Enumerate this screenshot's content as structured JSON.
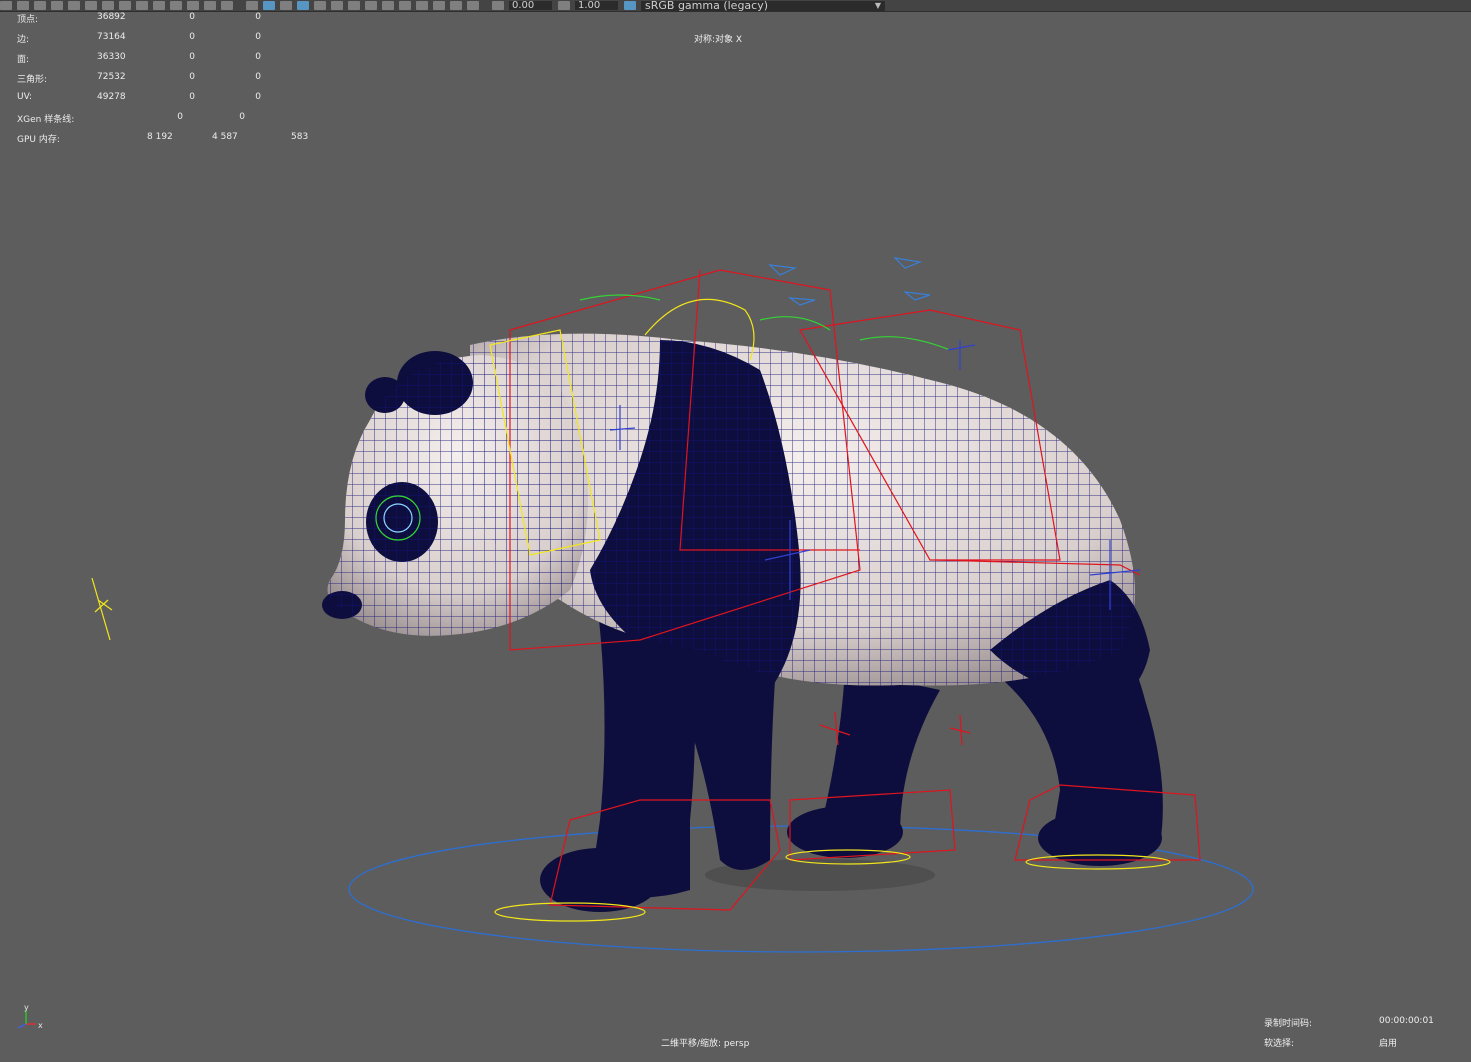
{
  "toolbar": {
    "exposure_value": "0.00",
    "gamma_value": "1.00",
    "color_space": "sRGB gamma (legacy)"
  },
  "hud": {
    "rows": [
      {
        "label": "顶点:",
        "v1": "36892",
        "v2": "0",
        "v3": "0"
      },
      {
        "label": "边:",
        "v1": "73164",
        "v2": "0",
        "v3": "0"
      },
      {
        "label": "面:",
        "v1": "36330",
        "v2": "0",
        "v3": "0"
      },
      {
        "label": "三角形:",
        "v1": "72532",
        "v2": "0",
        "v3": "0"
      },
      {
        "label": "UV:",
        "v1": "49278",
        "v2": "0",
        "v3": "0"
      }
    ],
    "xgen_label": "XGen 样条线:",
    "xgen_v1": "0",
    "xgen_v2": "0",
    "gpu_label": "GPU 内存:",
    "gpu_v1": "8 192",
    "gpu_v2": "4 587",
    "gpu_v3": "583"
  },
  "viewport": {
    "symmetry": "对称:对象 X",
    "camera": "二维平移/缩放: persp",
    "timecode_label": "录制时间码:",
    "timecode_value": "00:00:00:01",
    "soft_select_label": "软选择:",
    "soft_select_value": "启用"
  },
  "axis": {
    "x": "x",
    "y": "y"
  },
  "colors": {
    "viewport_bg": "#5d5d5d",
    "wire": "#14147a",
    "rig_red": "#e0141e",
    "rig_yellow": "#f2e61a",
    "rig_green": "#33d633",
    "rig_cyan": "#8ed8ff",
    "ground_circle": "#2d6fd1"
  }
}
